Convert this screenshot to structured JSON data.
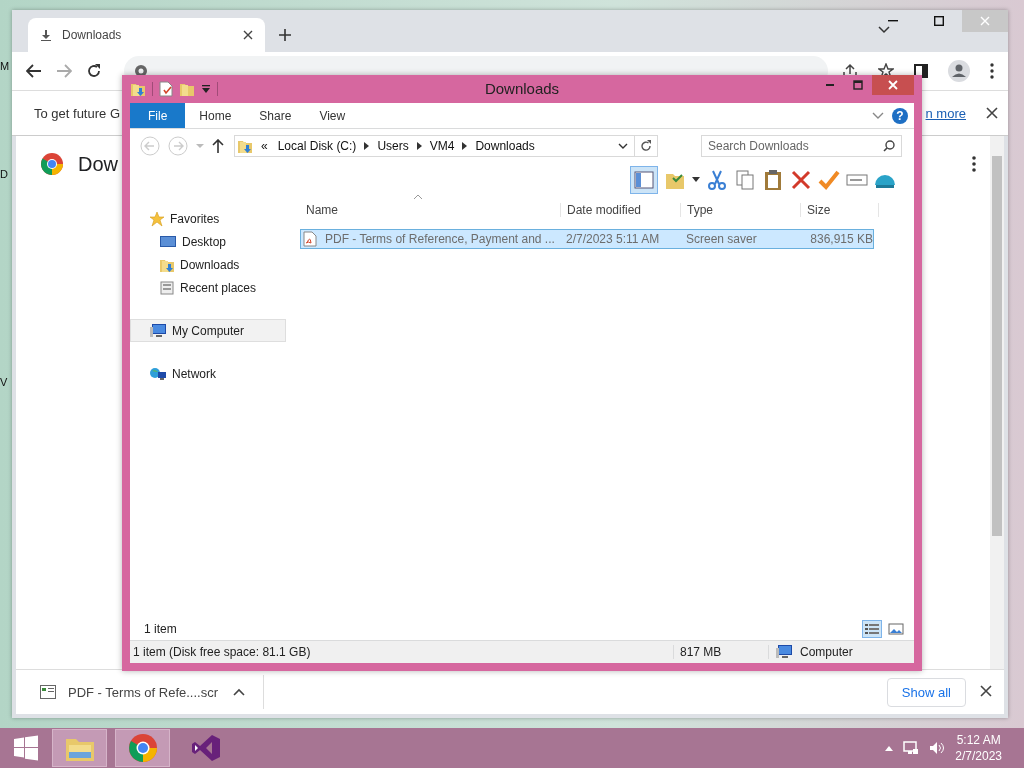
{
  "desktop": {
    "icon_labels": [
      "M",
      "D",
      "V"
    ]
  },
  "chrome": {
    "tabs": [
      {
        "label": "Downloads",
        "selected": true
      }
    ],
    "infobar": {
      "text": "To get future G",
      "link": "n more"
    },
    "page": {
      "title": "Dow"
    },
    "download_shelf": {
      "items": [
        {
          "name": "PDF - Terms of Refe....scr"
        }
      ],
      "show_all": "Show all"
    }
  },
  "explorer": {
    "title": "Downloads",
    "ribbon_tabs": [
      {
        "label": "File",
        "selected": true
      },
      {
        "label": "Home",
        "selected": false
      },
      {
        "label": "Share",
        "selected": false
      },
      {
        "label": "View",
        "selected": false
      }
    ],
    "help_glyph": "?",
    "overflow_glyph": "«",
    "breadcrumbs": [
      "Local Disk (C:)",
      "Users",
      "VM4",
      "Downloads"
    ],
    "search": {
      "placeholder": "Search Downloads"
    },
    "nav": [
      {
        "label": "Favorites",
        "kind": "star",
        "selected": false,
        "children": [
          {
            "label": "Desktop",
            "kind": "desktop",
            "selected": false
          },
          {
            "label": "Downloads",
            "kind": "downloads",
            "selected": false
          },
          {
            "label": "Recent places",
            "kind": "recent",
            "selected": false
          }
        ]
      },
      {
        "label": "My Computer",
        "kind": "computer",
        "selected": true
      },
      {
        "label": "Network",
        "kind": "network",
        "selected": false
      }
    ],
    "columns": [
      "Name",
      "Date modified",
      "Type",
      "Size"
    ],
    "rows": [
      {
        "name": "PDF - Terms of Reference, Payment and ...",
        "date": "2/7/2023 5:11 AM",
        "type": "Screen saver",
        "size": "836,915 KB",
        "selected": true
      }
    ],
    "item_count": "1 item",
    "views": [
      {
        "kind": "details",
        "selected": true
      },
      {
        "kind": "large-icons",
        "selected": false
      }
    ],
    "status_bar": {
      "text": "1 item (Disk free space: 81.1 GB)",
      "size": "817 MB",
      "location": "Computer"
    }
  },
  "taskbar": {
    "apps": [
      {
        "kind": "explorer",
        "active": true
      },
      {
        "kind": "chrome",
        "active": true
      },
      {
        "kind": "studio",
        "active": false
      }
    ],
    "clock": {
      "time": "5:12 AM",
      "date": "2/7/2023"
    }
  }
}
